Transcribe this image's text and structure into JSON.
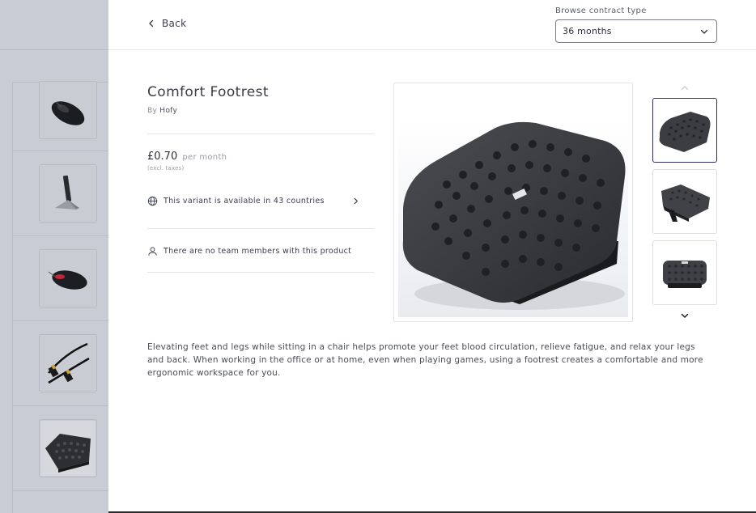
{
  "header": {
    "back_label": "Back",
    "contract_label": "Browse contract type",
    "contract_value": "36 months"
  },
  "product": {
    "title": "Comfort Footrest",
    "by_prefix": "By",
    "brand": "Hofy",
    "price": "£0.70",
    "price_period": "per month",
    "tax_note": "(excl. taxes)",
    "availability": "This variant is available in 43 countries",
    "team_members": "There are no team members with this product",
    "description": "Elevating feet and legs while sitting in a chair helps promote your feet blood circulation, relieve fatigue, and relax your legs and back. When working in the office or at home, even when playing games, using a footrest creates a comfortable and more ergonomic workspace for you."
  },
  "gallery": {
    "thumbnails": [
      "footrest-angle-view",
      "footrest-side-view",
      "footrest-front-view"
    ],
    "selected_index": 0
  },
  "background_list": {
    "items": [
      "mouse-black",
      "laptop-stand",
      "mouse-red-black",
      "hdmi-cable",
      "footrest"
    ]
  },
  "colors": {
    "overlay": "#c9ccd5",
    "selected_border": "#2d2f66",
    "text": "#3a3d48"
  }
}
